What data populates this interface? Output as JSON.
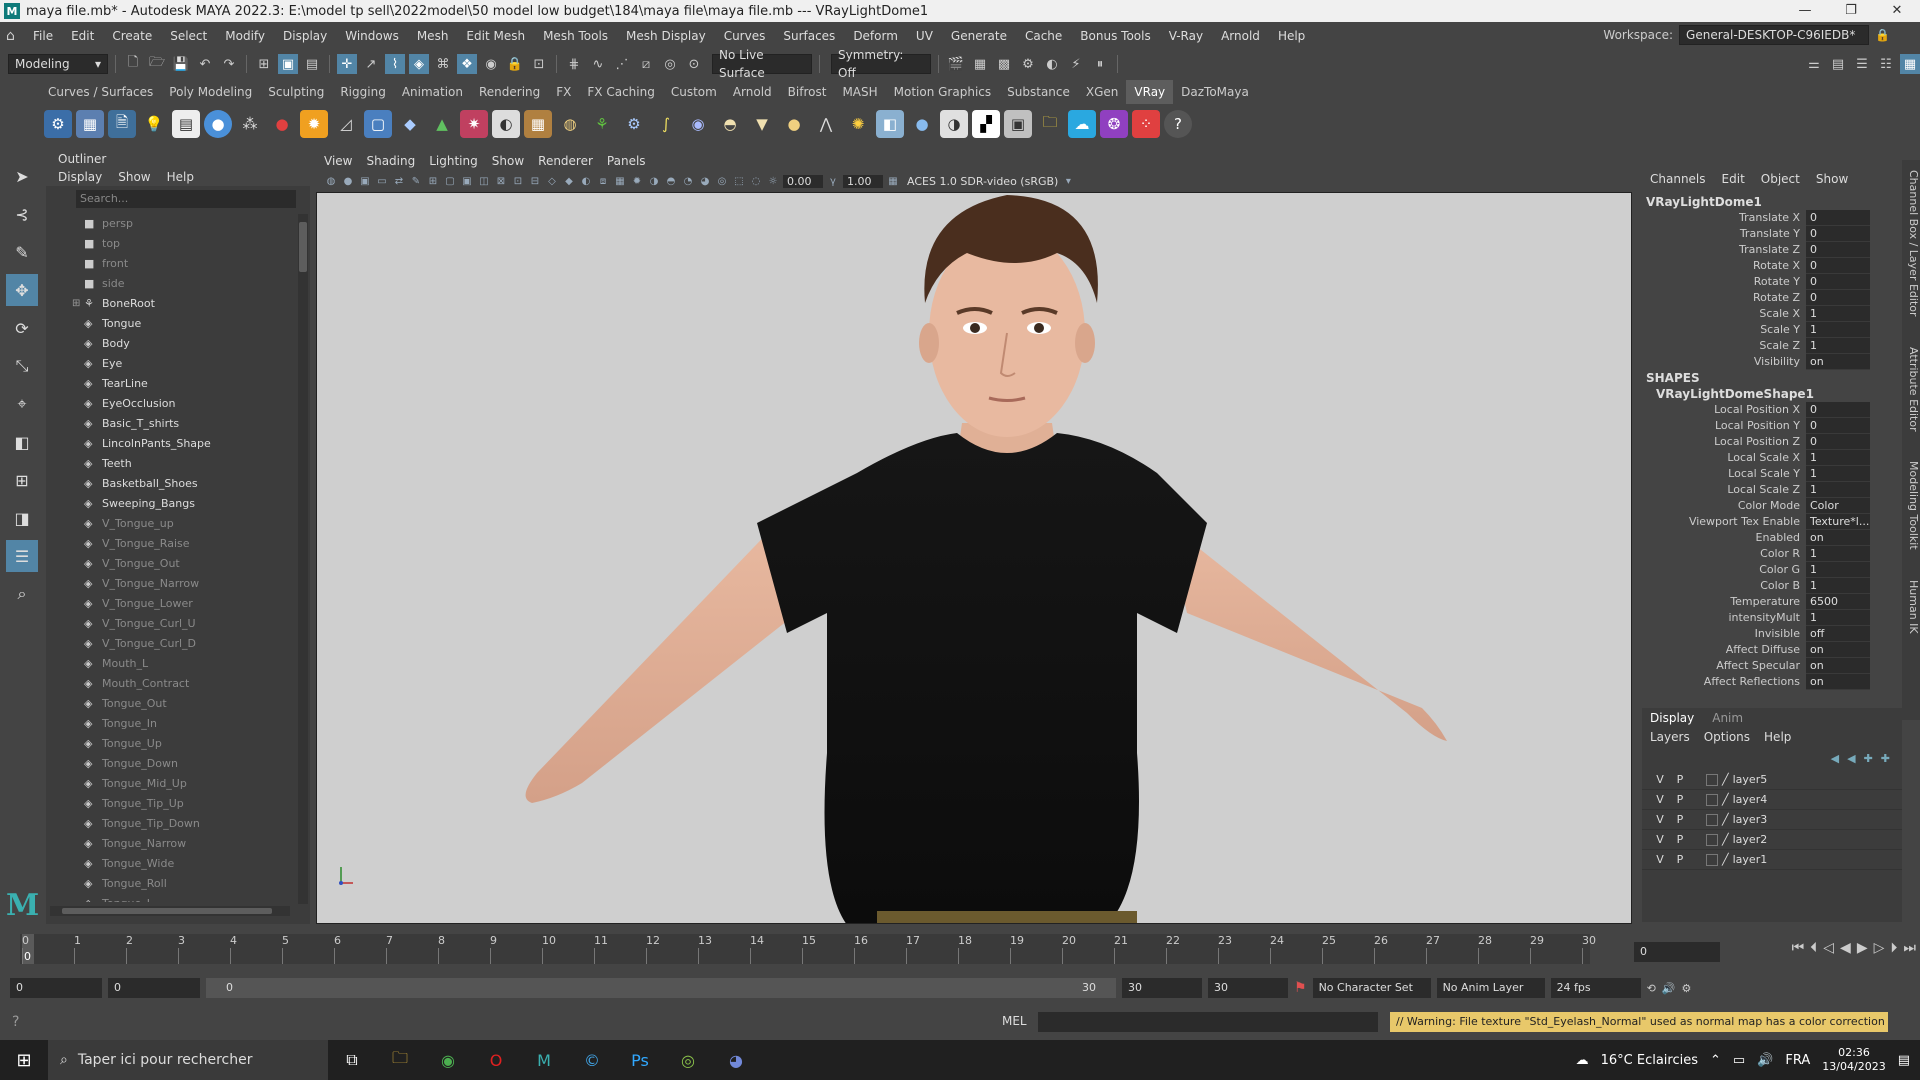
{
  "window": {
    "title": "maya file.mb* - Autodesk MAYA 2022.3: E:\\model tp sell\\2022model\\50 model low budget\\184\\maya file\\maya file.mb   ---   VRayLightDome1",
    "controls": [
      "—",
      "❐",
      "✕"
    ]
  },
  "menubar": {
    "items": [
      "File",
      "Edit",
      "Create",
      "Select",
      "Modify",
      "Display",
      "Windows",
      "Mesh",
      "Edit Mesh",
      "Mesh Tools",
      "Mesh Display",
      "Curves",
      "Surfaces",
      "Deform",
      "UV",
      "Generate",
      "Cache",
      "Bonus Tools",
      "V-Ray",
      "Arnold",
      "Help"
    ],
    "workspace_label": "Workspace:",
    "workspace_value": "General-DESKTOP-C96IEDB*"
  },
  "statusline": {
    "mode": "Modeling",
    "live_surface": "No Live Surface",
    "symmetry": "Symmetry: Off"
  },
  "shelf": {
    "tabs": [
      "Curves / Surfaces",
      "Poly Modeling",
      "Sculpting",
      "Rigging",
      "Animation",
      "Rendering",
      "FX",
      "FX Caching",
      "Custom",
      "Arnold",
      "Bifrost",
      "MASH",
      "Motion Graphics",
      "Substance",
      "XGen",
      "VRay",
      "DazToMaya"
    ],
    "active_tab": "VRay"
  },
  "outliner": {
    "title": "Outliner",
    "menu": [
      "Display",
      "Show",
      "Help"
    ],
    "search_placeholder": "Search...",
    "items": [
      {
        "label": "persp",
        "dim": true,
        "type": "camera"
      },
      {
        "label": "top",
        "dim": true,
        "type": "camera"
      },
      {
        "label": "front",
        "dim": true,
        "type": "camera"
      },
      {
        "label": "side",
        "dim": true,
        "type": "camera"
      },
      {
        "label": "BoneRoot",
        "dim": false,
        "type": "joint"
      },
      {
        "label": "Tongue",
        "dim": false,
        "type": "mesh"
      },
      {
        "label": "Body",
        "dim": false,
        "type": "mesh"
      },
      {
        "label": "Eye",
        "dim": false,
        "type": "mesh"
      },
      {
        "label": "TearLine",
        "dim": false,
        "type": "mesh"
      },
      {
        "label": "EyeOcclusion",
        "dim": false,
        "type": "mesh"
      },
      {
        "label": "Basic_T_shirts",
        "dim": false,
        "type": "mesh"
      },
      {
        "label": "LincolnPants_Shape",
        "dim": false,
        "type": "mesh"
      },
      {
        "label": "Teeth",
        "dim": false,
        "type": "mesh"
      },
      {
        "label": "Basketball_Shoes",
        "dim": false,
        "type": "mesh"
      },
      {
        "label": "Sweeping_Bangs",
        "dim": false,
        "type": "mesh"
      },
      {
        "label": "V_Tongue_up",
        "dim": true,
        "type": "mesh"
      },
      {
        "label": "V_Tongue_Raise",
        "dim": true,
        "type": "mesh"
      },
      {
        "label": "V_Tongue_Out",
        "dim": true,
        "type": "mesh"
      },
      {
        "label": "V_Tongue_Narrow",
        "dim": true,
        "type": "mesh"
      },
      {
        "label": "V_Tongue_Lower",
        "dim": true,
        "type": "mesh"
      },
      {
        "label": "V_Tongue_Curl_U",
        "dim": true,
        "type": "mesh"
      },
      {
        "label": "V_Tongue_Curl_D",
        "dim": true,
        "type": "mesh"
      },
      {
        "label": "Mouth_L",
        "dim": true,
        "type": "mesh"
      },
      {
        "label": "Mouth_Contract",
        "dim": true,
        "type": "mesh"
      },
      {
        "label": "Tongue_Out",
        "dim": true,
        "type": "mesh"
      },
      {
        "label": "Tongue_In",
        "dim": true,
        "type": "mesh"
      },
      {
        "label": "Tongue_Up",
        "dim": true,
        "type": "mesh"
      },
      {
        "label": "Tongue_Down",
        "dim": true,
        "type": "mesh"
      },
      {
        "label": "Tongue_Mid_Up",
        "dim": true,
        "type": "mesh"
      },
      {
        "label": "Tongue_Tip_Up",
        "dim": true,
        "type": "mesh"
      },
      {
        "label": "Tongue_Tip_Down",
        "dim": true,
        "type": "mesh"
      },
      {
        "label": "Tongue_Narrow",
        "dim": true,
        "type": "mesh"
      },
      {
        "label": "Tongue_Wide",
        "dim": true,
        "type": "mesh"
      },
      {
        "label": "Tongue_Roll",
        "dim": true,
        "type": "mesh"
      },
      {
        "label": "Tongue_L",
        "dim": true,
        "type": "mesh"
      }
    ]
  },
  "viewport": {
    "menu": [
      "View",
      "Shading",
      "Lighting",
      "Show",
      "Renderer",
      "Panels"
    ],
    "exposure": "0.00",
    "gamma": "1.00",
    "colorspace": "ACES 1.0 SDR-video (sRGB)"
  },
  "channelbox": {
    "menu": [
      "Channels",
      "Edit",
      "Object",
      "Show"
    ],
    "object": "VRayLightDome1",
    "attrs": [
      {
        "label": "Translate X",
        "value": "0"
      },
      {
        "label": "Translate Y",
        "value": "0"
      },
      {
        "label": "Translate Z",
        "value": "0"
      },
      {
        "label": "Rotate X",
        "value": "0"
      },
      {
        "label": "Rotate Y",
        "value": "0"
      },
      {
        "label": "Rotate Z",
        "value": "0"
      },
      {
        "label": "Scale X",
        "value": "1"
      },
      {
        "label": "Scale Y",
        "value": "1"
      },
      {
        "label": "Scale Z",
        "value": "1"
      },
      {
        "label": "Visibility",
        "value": "on"
      }
    ],
    "shapes_header": "SHAPES",
    "shape_name": "VRayLightDomeShape1",
    "shape_attrs": [
      {
        "label": "Local Position X",
        "value": "0"
      },
      {
        "label": "Local Position Y",
        "value": "0"
      },
      {
        "label": "Local Position Z",
        "value": "0"
      },
      {
        "label": "Local Scale X",
        "value": "1"
      },
      {
        "label": "Local Scale Y",
        "value": "1"
      },
      {
        "label": "Local Scale Z",
        "value": "1"
      },
      {
        "label": "Color Mode",
        "value": "Color"
      },
      {
        "label": "Viewport Tex Enable",
        "value": "Texture*l..."
      },
      {
        "label": "Enabled",
        "value": "on"
      },
      {
        "label": "Color R",
        "value": "1"
      },
      {
        "label": "Color G",
        "value": "1"
      },
      {
        "label": "Color B",
        "value": "1"
      },
      {
        "label": "Temperature",
        "value": "6500"
      },
      {
        "label": "intensityMult",
        "value": "1"
      },
      {
        "label": "Invisible",
        "value": "off"
      },
      {
        "label": "Affect Diffuse",
        "value": "on"
      },
      {
        "label": "Affect Specular",
        "value": "on"
      },
      {
        "label": "Affect Reflections",
        "value": "on"
      }
    ],
    "side_tabs": [
      "Channel Box / Layer Editor",
      "Attribute Editor",
      "Modeling Toolkit",
      "Human IK"
    ]
  },
  "layers": {
    "tabs": [
      "Display",
      "Anim"
    ],
    "menu": [
      "Layers",
      "Options",
      "Help"
    ],
    "rows": [
      {
        "v": "V",
        "p": "P",
        "name": "layer5"
      },
      {
        "v": "V",
        "p": "P",
        "name": "layer4"
      },
      {
        "v": "V",
        "p": "P",
        "name": "layer3"
      },
      {
        "v": "V",
        "p": "P",
        "name": "layer2"
      },
      {
        "v": "V",
        "p": "P",
        "name": "layer1"
      }
    ]
  },
  "timeline": {
    "ticks": [
      "0",
      "1",
      "2",
      "3",
      "4",
      "5",
      "6",
      "7",
      "8",
      "9",
      "10",
      "11",
      "12",
      "13",
      "14",
      "15",
      "16",
      "17",
      "18",
      "19",
      "20",
      "21",
      "22",
      "23",
      "24",
      "25",
      "26",
      "27",
      "28",
      "29",
      "30"
    ],
    "current_frame": "0",
    "current_field": "0"
  },
  "range": {
    "start": "0",
    "anim_start": "0",
    "slider_start": "0",
    "slider_end": "30",
    "end": "30",
    "anim_end": "30",
    "character_set": "No Character Set",
    "anim_layer": "No Anim Layer",
    "fps": "24 fps"
  },
  "cmdline": {
    "label": "MEL",
    "warning": "// Warning: File texture \"Std_Eyelash_Normal\" used as normal map has a color correction enabled"
  },
  "taskbar": {
    "search_placeholder": "Taper ici pour rechercher",
    "weather": "16°C  Eclaircies",
    "lang": "FRA",
    "time": "02:36",
    "date": "13/04/2023"
  },
  "colors": {
    "accent": "#5285a6",
    "background": "#444444",
    "viewport_bg": "#cfcfcf",
    "warning": "#e8c86a"
  }
}
